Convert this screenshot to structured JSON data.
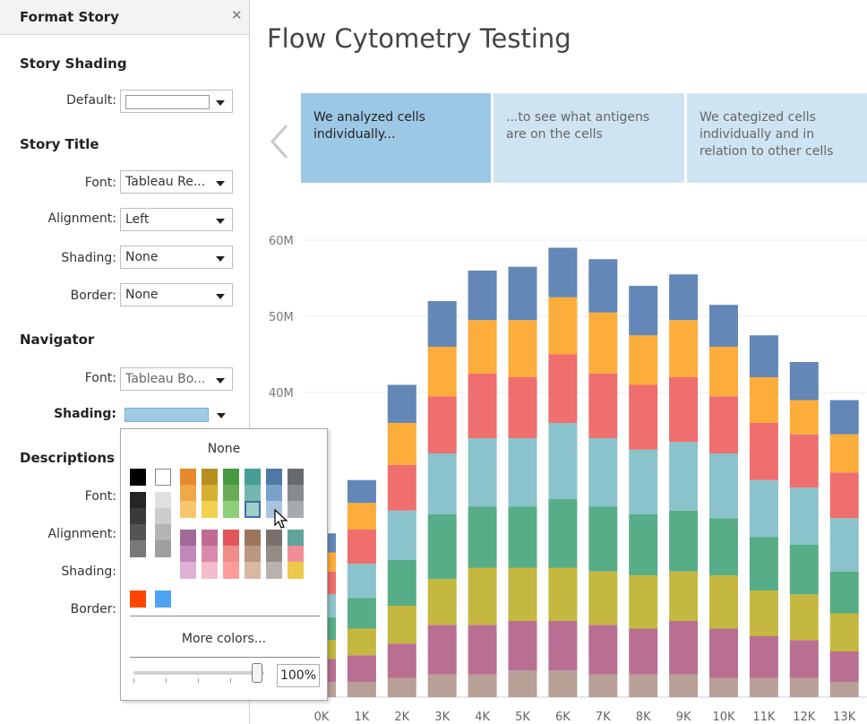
{
  "panel": {
    "title": "Format Story",
    "close_icon": "close-icon",
    "story_shading": {
      "heading": "Story Shading",
      "default_label": "Default:",
      "default_value": "#ffffff"
    },
    "story_title": {
      "heading": "Story Title",
      "font_label": "Font:",
      "font_value": "Tableau Re...",
      "alignment_label": "Alignment:",
      "alignment_value": "Left",
      "shading_label": "Shading:",
      "shading_value": "None",
      "border_label": "Border:",
      "border_value": "None"
    },
    "navigator": {
      "heading": "Navigator",
      "font_label": "Font:",
      "font_value": "Tableau Bo...",
      "shading_label": "Shading:",
      "shading_value": "#9fcae6"
    },
    "descriptions": {
      "heading": "Descriptions",
      "font_label": "Font:",
      "alignment_label": "Alignment:",
      "shading_label": "Shading:",
      "border_label": "Border:"
    }
  },
  "color_popup": {
    "none_label": "None",
    "more_colors_label": "More colors...",
    "opacity_value": "100%",
    "grays": [
      "#000000",
      "#ffffff",
      "#252525",
      "#e0e0e0",
      "#3a3a3a",
      "#cccccc",
      "#545454",
      "#b4b4b4",
      "#787878",
      "#9e9e9e"
    ],
    "palette_rows": [
      [
        "#e8882d",
        "#b59020",
        "#469940",
        "#489d96",
        "#4e79a7",
        "#666b70"
      ],
      [
        "#f1a849",
        "#d6b033",
        "#6aab58",
        "#73b6ae",
        "#7aa1cb",
        "#868b90"
      ],
      [
        "#f7c66c",
        "#f0d150",
        "#8fcf7a",
        "#a0cec8",
        "#a8c4e0",
        "#a7abae"
      ],
      [
        "#a06a9a",
        "#c06a93",
        "#e15759",
        "#9c755f",
        "#79706e",
        "#5fa49b"
      ],
      [
        "#c188b9",
        "#d98aaa",
        "#f28c89",
        "#bc9680",
        "#958b87",
        "#f08e95"
      ],
      [
        "#dcb1d4",
        "#f5bccb",
        "#ff9d9a",
        "#d8b7a3",
        "#bab0ac",
        "#edc948"
      ]
    ],
    "recent": [
      "#ff4500",
      "#4da3f2"
    ],
    "selected_color": "#a0cec8",
    "slider_percent": 100
  },
  "story": {
    "title": "Flow Cytometry Testing",
    "prev_icon": "chevron-left-icon",
    "points": [
      {
        "text": "We analyzed cells individually...",
        "active": true
      },
      {
        "text": "...to see what antigens are on the cells",
        "active": false
      },
      {
        "text": "We categized cells individually and in relation to other cells",
        "active": false
      }
    ]
  },
  "chart_data": {
    "type": "bar",
    "stacked": true,
    "categories": [
      "0K",
      "1K",
      "2K",
      "3K",
      "4K",
      "5K",
      "6K",
      "7K",
      "8K",
      "9K",
      "10K",
      "11K",
      "12K",
      "13K"
    ],
    "ylim": [
      0,
      60
    ],
    "yticks": [
      "40M",
      "50M",
      "60M"
    ],
    "ytick_values": [
      40,
      50,
      60
    ],
    "grid": true,
    "series_colors": [
      "#b9a097",
      "#b96f92",
      "#c4b840",
      "#57ad87",
      "#8bc3cc",
      "#ee6f6d",
      "#fdad3b",
      "#6387b6"
    ],
    "series": [
      {
        "values": [
          2,
          2,
          2.5,
          3,
          3,
          3.5,
          3.5,
          3,
          3,
          3,
          2.5,
          2.5,
          2.5,
          2
        ]
      },
      {
        "values": [
          3,
          3.5,
          4.5,
          6.5,
          6.5,
          6.5,
          6.5,
          6.5,
          6,
          7,
          6.5,
          5.5,
          5,
          4
        ]
      },
      {
        "values": [
          2.5,
          3.5,
          5,
          6,
          7.5,
          7,
          7,
          7,
          7,
          6.5,
          7,
          6,
          6,
          5
        ]
      },
      {
        "values": [
          3,
          4,
          6,
          8.5,
          8,
          8,
          9,
          8.5,
          8,
          8,
          7.5,
          7,
          6.5,
          5.5
        ]
      },
      {
        "values": [
          3,
          4.5,
          6.5,
          8,
          9,
          9,
          10,
          9,
          8.5,
          9,
          8.5,
          7.5,
          7.5,
          7
        ]
      },
      {
        "values": [
          3,
          4.5,
          6,
          7.5,
          8.5,
          8,
          9,
          8.5,
          8.5,
          8.5,
          7.5,
          7.5,
          7,
          6
        ]
      },
      {
        "values": [
          2.5,
          3.5,
          5.5,
          6.5,
          7,
          7.5,
          7.5,
          8,
          6.5,
          7.5,
          6.5,
          6,
          4.5,
          5
        ]
      },
      {
        "values": [
          2.5,
          3,
          5,
          6,
          6.5,
          7,
          6.5,
          7,
          6.5,
          6,
          5.5,
          5.5,
          5,
          4.5
        ]
      }
    ]
  }
}
